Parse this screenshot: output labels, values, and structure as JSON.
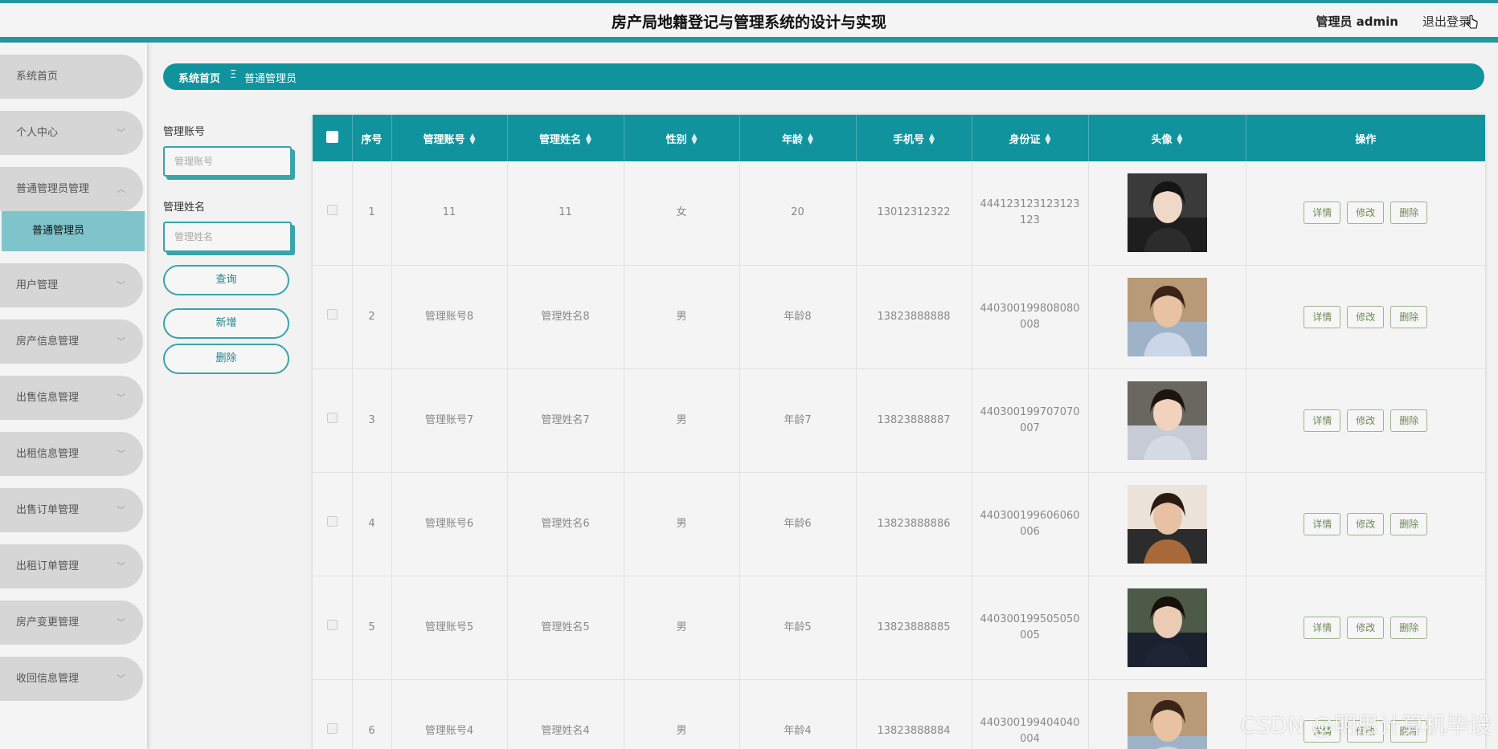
{
  "header": {
    "title": "房产局地籍登记与管理系统的设计与实现",
    "admin": "管理员 admin",
    "logout": "退出登录"
  },
  "sidebar": {
    "items": [
      {
        "label": "系统首页",
        "chevron": ""
      },
      {
        "label": "个人中心",
        "chevron": "﹀"
      },
      {
        "label": "普通管理员管理",
        "chevron": "︿",
        "open": true
      },
      {
        "label": "用户管理",
        "chevron": "﹀"
      },
      {
        "label": "房产信息管理",
        "chevron": "﹀"
      },
      {
        "label": "出售信息管理",
        "chevron": "﹀"
      },
      {
        "label": "出租信息管理",
        "chevron": "﹀"
      },
      {
        "label": "出售订单管理",
        "chevron": "﹀"
      },
      {
        "label": "出租订单管理",
        "chevron": "﹀"
      },
      {
        "label": "房产变更管理",
        "chevron": "﹀"
      },
      {
        "label": "收回信息管理",
        "chevron": "﹀"
      }
    ],
    "submenu": {
      "label": "普通管理员"
    }
  },
  "breadcrumb": {
    "home": "系统首页",
    "separator": "Ξ",
    "current": "普通管理员"
  },
  "search": {
    "account_label": "管理账号",
    "account_placeholder": "管理账号",
    "name_label": "管理姓名",
    "name_placeholder": "管理姓名",
    "query_button": "查询",
    "add_button": "新增",
    "delete_button": "删除"
  },
  "table": {
    "columns": {
      "index": "序号",
      "account": "管理账号",
      "name": "管理姓名",
      "gender": "性别",
      "age": "年龄",
      "phone": "手机号",
      "id_card": "身份证",
      "avatar": "头像",
      "actions": "操作"
    },
    "actions": {
      "detail": "详情",
      "edit": "修改",
      "delete": "删除"
    },
    "rows": [
      {
        "index": "1",
        "account": "11",
        "name": "11",
        "gender": "女",
        "age": "20",
        "phone": "13012312322",
        "id_card": "444123123123123123"
      },
      {
        "index": "2",
        "account": "管理账号8",
        "name": "管理姓名8",
        "gender": "男",
        "age": "年龄8",
        "phone": "13823888888",
        "id_card": "440300199808080008"
      },
      {
        "index": "3",
        "account": "管理账号7",
        "name": "管理姓名7",
        "gender": "男",
        "age": "年龄7",
        "phone": "13823888887",
        "id_card": "440300199707070007"
      },
      {
        "index": "4",
        "account": "管理账号6",
        "name": "管理姓名6",
        "gender": "男",
        "age": "年龄6",
        "phone": "13823888886",
        "id_card": "440300199606060006"
      },
      {
        "index": "5",
        "account": "管理账号5",
        "name": "管理姓名5",
        "gender": "男",
        "age": "年龄5",
        "phone": "13823888885",
        "id_card": "440300199505050005"
      },
      {
        "index": "6",
        "account": "管理账号4",
        "name": "管理姓名4",
        "gender": "男",
        "age": "年龄4",
        "phone": "13823888884",
        "id_card": "440300199404040004"
      }
    ]
  },
  "watermark": "CSDN @明思计算机毕设"
}
